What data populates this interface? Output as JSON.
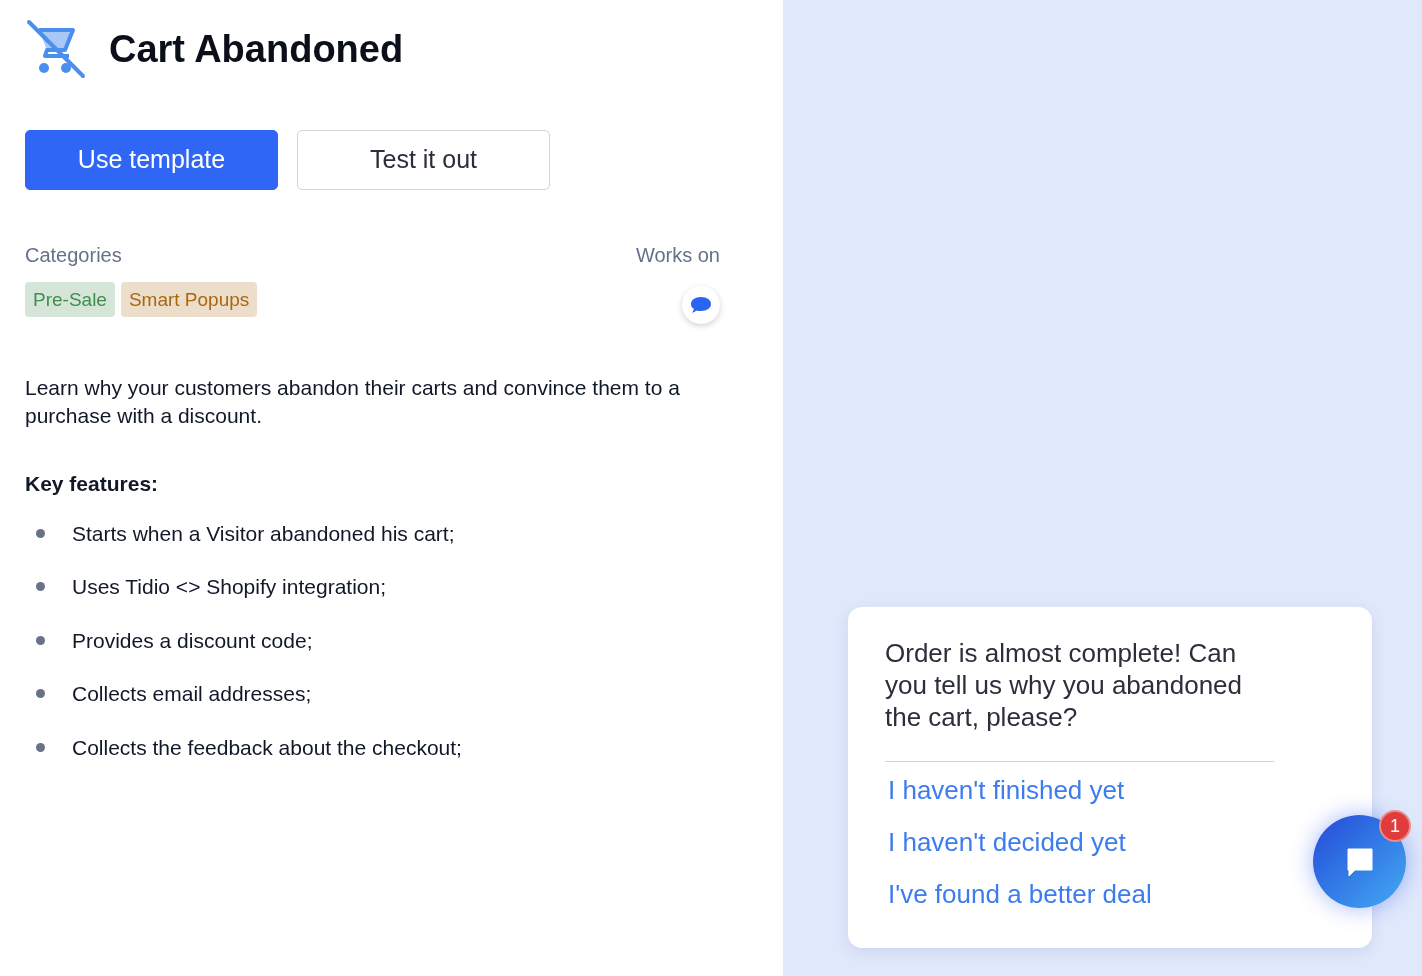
{
  "header": {
    "title": "Cart Abandoned"
  },
  "buttons": [
    {
      "label": "Use template",
      "kind": "primary"
    },
    {
      "label": "Test it out",
      "kind": "secondary"
    }
  ],
  "categories": {
    "label": "Categories",
    "tags": [
      {
        "label": "Pre-Sale",
        "color": "#3f8f4f"
      },
      {
        "label": "Smart Popups",
        "color": "#a9670f"
      }
    ]
  },
  "works_on": {
    "label": "Works on"
  },
  "description": "Learn why your customers abandon their carts and convince them to a purchase with a discount.",
  "features": {
    "heading": "Key features:",
    "items": [
      "Starts when a Visitor abandoned his cart;",
      "Uses Tidio <> Shopify integration;",
      "Provides a discount code;",
      "Collects email addresses;",
      "Collects the feedback about the checkout;"
    ]
  },
  "preview": {
    "message": "Order is almost complete! Can you tell us why you abandoned the cart, please?",
    "replies": [
      "I haven't finished yet",
      "I haven't decided yet",
      "I've found a better deal"
    ],
    "badge": "1"
  }
}
